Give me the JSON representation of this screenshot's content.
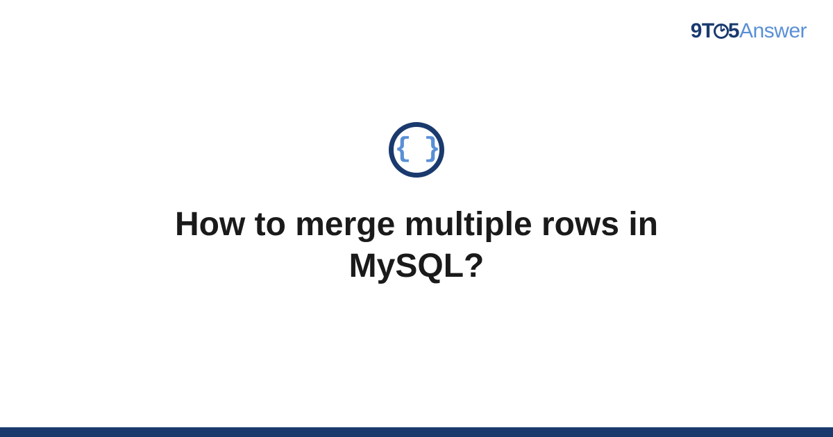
{
  "brand": {
    "prefix": "9T",
    "middle": "5",
    "suffix": "Answer"
  },
  "icon": {
    "glyph": "{ }"
  },
  "question": {
    "title": "How to merge multiple rows in MySQL?"
  }
}
